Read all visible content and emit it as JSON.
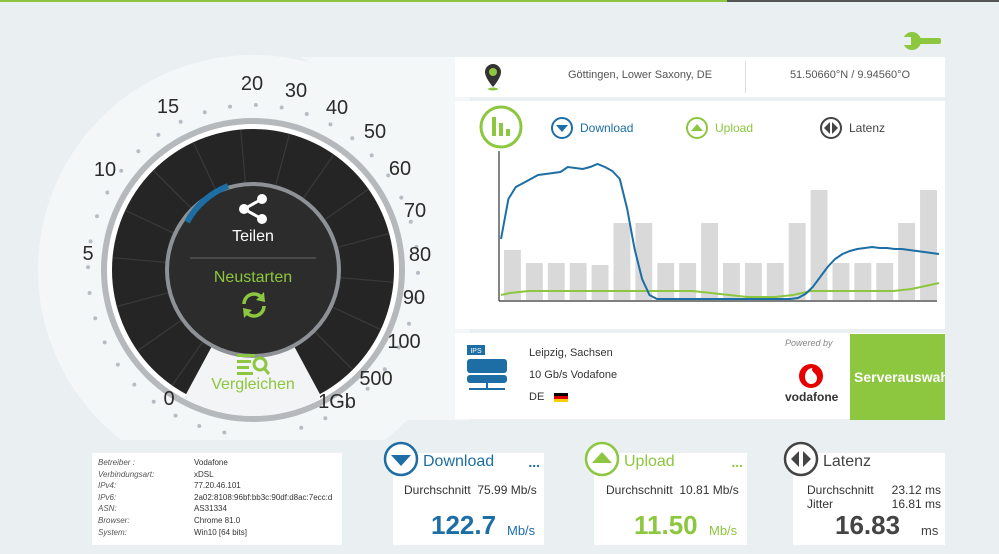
{
  "colors": {
    "green": "#8dc63f",
    "blue": "#1c6ea4",
    "gauge": "#222222",
    "vodafone_red": "#e60000"
  },
  "icons": {
    "settings": "wrench-icon",
    "location": "map-pin-icon",
    "share": "share-icon",
    "restart": "refresh-icon",
    "compare": "compare-icon",
    "server": "server-icon"
  },
  "location": {
    "city": "Göttingen, Lower Saxony, DE",
    "coords": "51.50660°N / 9.94560°O"
  },
  "gauge": {
    "ticks": [
      "0",
      "5",
      "10",
      "15",
      "20",
      "30",
      "40",
      "50",
      "60",
      "70",
      "80",
      "90",
      "100",
      "500",
      "1Gb"
    ],
    "share_label": "Teilen",
    "restart_label": "Neustarten",
    "compare_label": "Vergleichen"
  },
  "legend": {
    "download": "Download",
    "upload": "Upload",
    "latency": "Latenz"
  },
  "graph": {
    "bars": [
      50,
      37,
      37,
      37,
      35,
      77,
      77,
      37,
      37,
      77,
      37,
      37,
      37,
      77,
      110,
      37,
      37,
      37,
      77,
      110
    ],
    "download": [
      60,
      100,
      112,
      116,
      120,
      124,
      125,
      126,
      127,
      132,
      131,
      130,
      132,
      135,
      132,
      128,
      120,
      90,
      50,
      20,
      4,
      0,
      0,
      0,
      0,
      0,
      0,
      0,
      0,
      0,
      0,
      0,
      0,
      0,
      0,
      0,
      0,
      0,
      0,
      0,
      1,
      5,
      12,
      22,
      32,
      40,
      45,
      48,
      50,
      51,
      52,
      51,
      51,
      50,
      50,
      49,
      48,
      47,
      46,
      45
    ],
    "upload": [
      4,
      6,
      7,
      8,
      8,
      8,
      8,
      8,
      8,
      8,
      8,
      8,
      8,
      8,
      8,
      8,
      8,
      8,
      8,
      8,
      8,
      8,
      7,
      6,
      5,
      4,
      3,
      2,
      2,
      2,
      2,
      3,
      4,
      6,
      8,
      8,
      8,
      8,
      8,
      8,
      8,
      8,
      8,
      8,
      9,
      10,
      12,
      14,
      16
    ]
  },
  "server": {
    "ips": "IPS",
    "city": "Leipzig, Sachsen",
    "provider": "10 Gb/s Vodafone",
    "country": "DE",
    "powered_by": "Powered by",
    "vodafone": "vodafone",
    "select_label": "Serverauswahl"
  },
  "isp": [
    {
      "k": "Betreiber :",
      "v": "Vodafone"
    },
    {
      "k": "Verbindungsart:",
      "v": "xDSL"
    },
    {
      "k": "IPv4:",
      "v": "77.20.46.101"
    },
    {
      "k": "IPv6:",
      "v": "2a02:8108:96bf:bb3c:90df:d8ac:7ecc:d"
    },
    {
      "k": "ASN:",
      "v": "AS31334"
    },
    {
      "k": "Browser:",
      "v": "Chrome 81.0"
    },
    {
      "k": "System:",
      "v": "Win10 [64 bits]"
    }
  ],
  "stats": {
    "download": {
      "title": "Download",
      "more": "...",
      "avg_label": "Durchschnitt",
      "avg_value": "75.99 Mb/s",
      "value": "122.7",
      "unit": "Mb/s"
    },
    "upload": {
      "title": "Upload",
      "more": "...",
      "avg_label": "Durchschnitt",
      "avg_value": "10.81 Mb/s",
      "value": "11.50",
      "unit": "Mb/s"
    },
    "latency": {
      "title": "Latenz",
      "avg_label": "Durchschnitt",
      "avg_value": "23.12 ms",
      "jitter_label": "Jitter",
      "jitter_value": "16.81 ms",
      "value": "16.83",
      "unit": "ms"
    }
  }
}
